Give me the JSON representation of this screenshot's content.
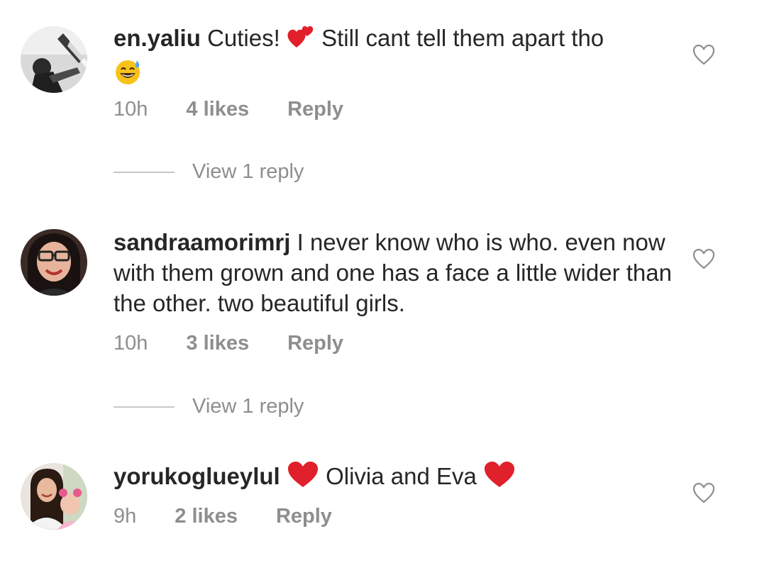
{
  "comments": [
    {
      "username": "en.yaliu",
      "text_a": "Cuties!",
      "text_b": "Still cant tell them apart tho",
      "time": "10h",
      "likes": "4 likes",
      "reply": "Reply",
      "view_replies": "View 1 reply"
    },
    {
      "username": "sandraamorimrj",
      "text": "I never know who is who. even now with them grown and one has a face a little wider than the other. two beautiful girls.",
      "time": "10h",
      "likes": "3 likes",
      "reply": "Reply",
      "view_replies": "View 1 reply"
    },
    {
      "username": "yorukoglueylul",
      "text_a": "Olivia and Eva",
      "time": "9h",
      "likes": "2 likes",
      "reply": "Reply"
    }
  ],
  "icons": {
    "like": "heart-outline-icon",
    "emoji_hearts": "two-hearts-emoji",
    "emoji_sweat": "grinning-sweat-emoji",
    "emoji_heart": "red-heart-emoji"
  },
  "colors": {
    "text": "#262626",
    "secondary": "#8e8e8e",
    "heart_red": "#e0202a"
  }
}
